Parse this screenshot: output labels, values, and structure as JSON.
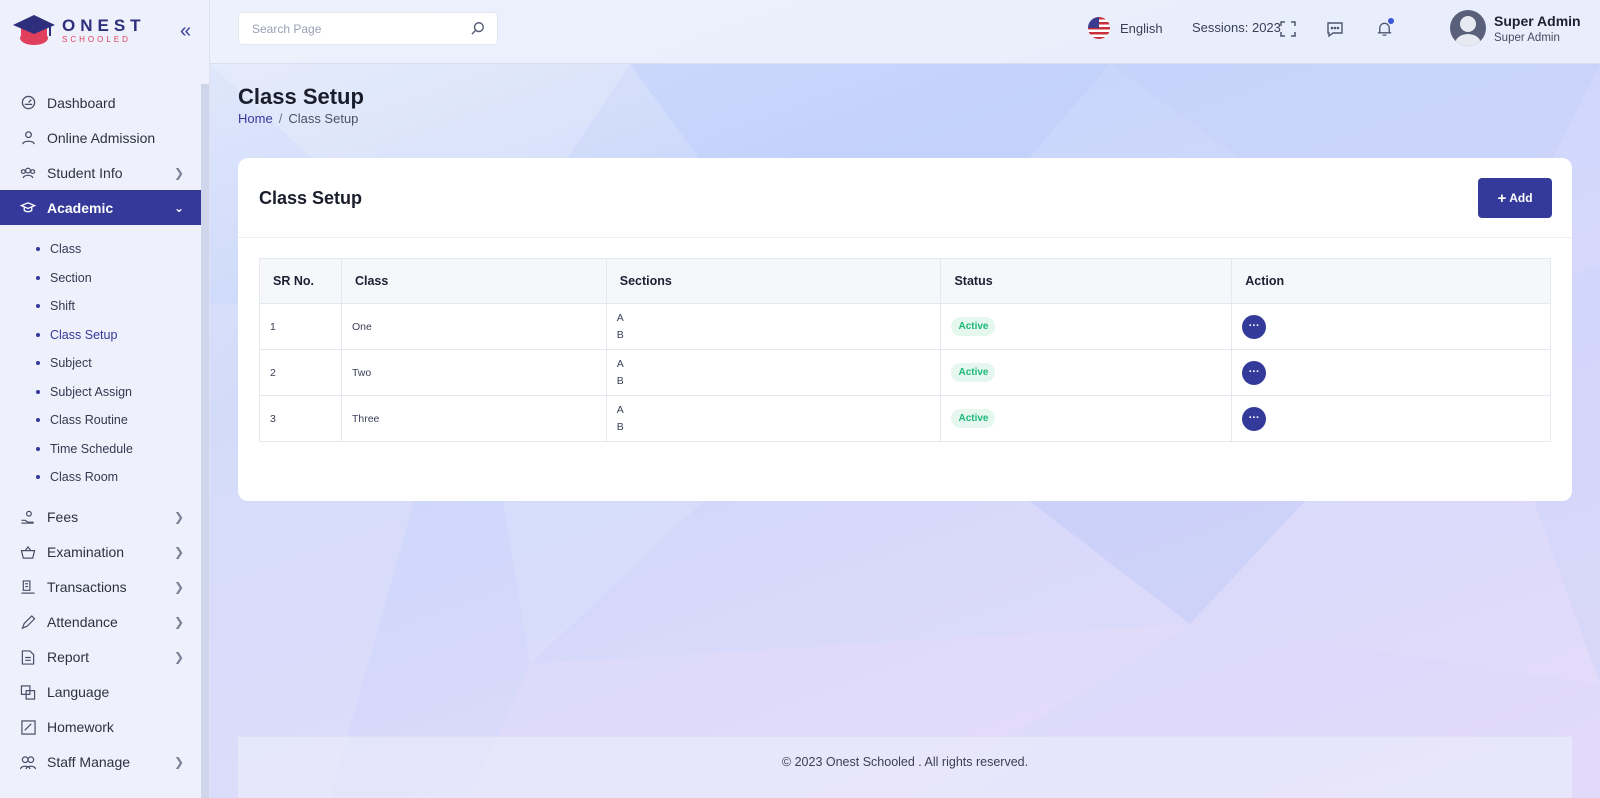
{
  "brand": {
    "name": "ONEST",
    "tagline": "SCHOOLED"
  },
  "search": {
    "placeholder": "Search Page"
  },
  "topbar": {
    "language": "English",
    "session": "Sessions: 2023",
    "user_name": "Super Admin",
    "user_role": "Super Admin",
    "icons": [
      "fullscreen-icon",
      "message-icon",
      "bell-icon"
    ]
  },
  "sidebar": {
    "items": [
      {
        "label": "Dashboard",
        "icon": "dashboard-icon",
        "expandable": false
      },
      {
        "label": "Online Admission",
        "icon": "user-icon",
        "expandable": false
      },
      {
        "label": "Student Info",
        "icon": "students-icon",
        "expandable": true
      },
      {
        "label": "Academic",
        "icon": "graduation-cap-icon",
        "expandable": true,
        "active": true
      },
      {
        "label": "Fees",
        "icon": "hand-coin-icon",
        "expandable": true
      },
      {
        "label": "Examination",
        "icon": "basket-icon",
        "expandable": true
      },
      {
        "label": "Transactions",
        "icon": "transactions-icon",
        "expandable": true
      },
      {
        "label": "Attendance",
        "icon": "pen-icon",
        "expandable": true
      },
      {
        "label": "Report",
        "icon": "report-icon",
        "expandable": true
      },
      {
        "label": "Language",
        "icon": "language-icon",
        "expandable": false
      },
      {
        "label": "Homework",
        "icon": "homework-icon",
        "expandable": false
      },
      {
        "label": "Staff Manage",
        "icon": "staff-icon",
        "expandable": true
      }
    ],
    "academic_sub": [
      {
        "label": "Class"
      },
      {
        "label": "Section"
      },
      {
        "label": "Shift"
      },
      {
        "label": "Class Setup",
        "active": true
      },
      {
        "label": "Subject"
      },
      {
        "label": "Subject Assign"
      },
      {
        "label": "Class Routine"
      },
      {
        "label": "Time Schedule"
      },
      {
        "label": "Class Room"
      }
    ]
  },
  "page": {
    "title": "Class Setup",
    "breadcrumb_home": "Home",
    "breadcrumb_sep": "/",
    "breadcrumb_current": "Class Setup"
  },
  "card": {
    "title": "Class Setup",
    "add_label": "Add"
  },
  "table": {
    "headers": [
      "SR No.",
      "Class",
      "Sections",
      "Status",
      "Action"
    ],
    "rows": [
      {
        "sr": "1",
        "class": "One",
        "sections": [
          "A",
          "B"
        ],
        "status": "Active",
        "action": "···"
      },
      {
        "sr": "2",
        "class": "Two",
        "sections": [
          "A",
          "B"
        ],
        "status": "Active",
        "action": "···"
      },
      {
        "sr": "3",
        "class": "Three",
        "sections": [
          "A",
          "B"
        ],
        "status": "Active",
        "action": "···"
      }
    ]
  },
  "footer": {
    "text": "© 2023 Onest Schooled . All rights reserved."
  },
  "colors": {
    "primary": "#343a99",
    "status_active": "#1db87a",
    "status_active_bg": "#e5f7ee"
  }
}
